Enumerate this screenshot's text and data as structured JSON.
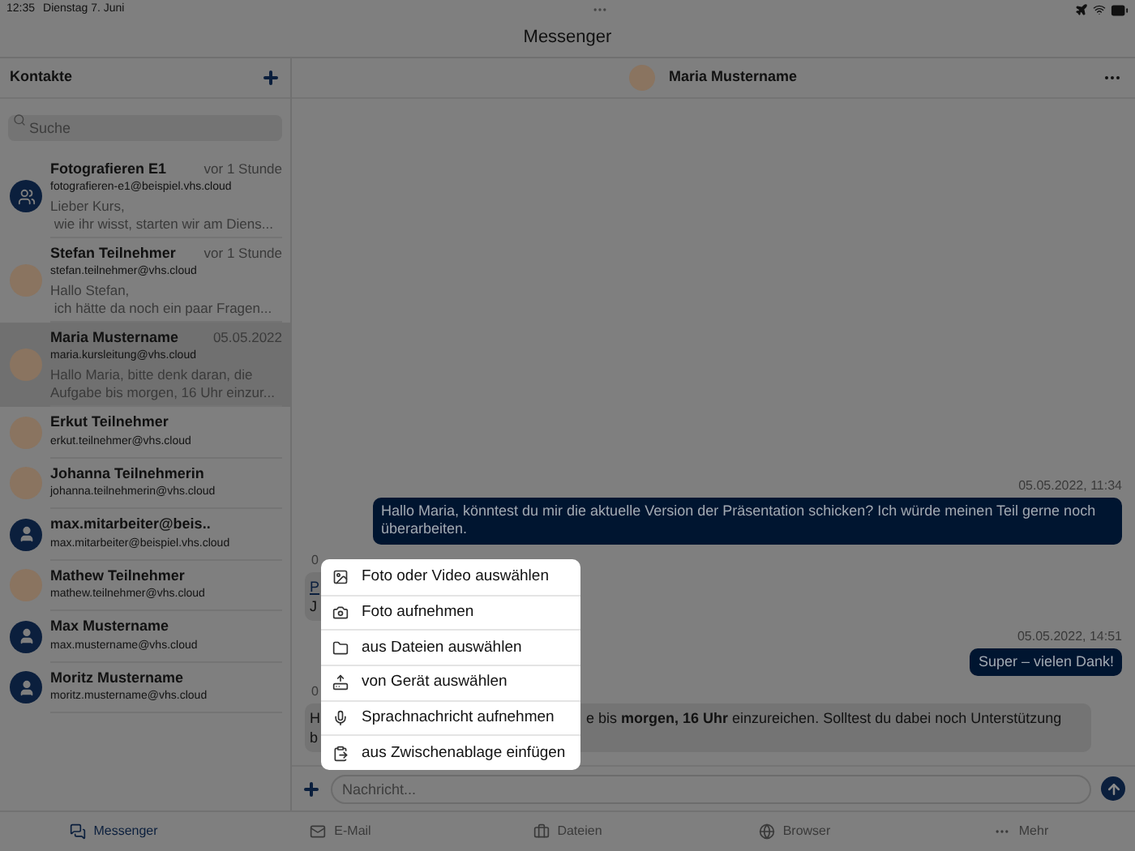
{
  "status_bar": {
    "time": "12:35",
    "date": "Dienstag 7. Juni"
  },
  "title": "Messenger",
  "sidebar": {
    "title": "Kontakte",
    "search": {
      "placeholder": "Suche"
    },
    "contacts": [
      {
        "name": "Fotografieren E1",
        "email": "fotografieren-e1@beispiel.vhs.cloud",
        "time": "vor 1 Stunde",
        "preview": [
          "Lieber Kurs,",
          " wie ihr wisst, starten wir am Diens..."
        ],
        "kind": "group",
        "selected": false
      },
      {
        "name": "Stefan Teilnehmer",
        "email": "stefan.teilnehmer@vhs.cloud",
        "time": "vor 1 Stunde",
        "preview": [
          "Hallo Stefan,",
          " ich hätte da noch ein paar Fragen..."
        ],
        "kind": "photo",
        "selected": false
      },
      {
        "name": "Maria Mustername",
        "email": "maria.kursleitung@vhs.cloud",
        "time": "05.05.2022",
        "preview": [
          "Hallo Maria, bitte denk daran, die",
          "Aufgabe bis morgen, 16 Uhr einzur..."
        ],
        "kind": "photo",
        "selected": true
      },
      {
        "name": "Erkut Teilnehmer",
        "email": "erkut.teilnehmer@vhs.cloud",
        "kind": "photo",
        "selected": false
      },
      {
        "name": "Johanna Teilnehmerin",
        "email": "johanna.teilnehmerin@vhs.cloud",
        "kind": "photo",
        "selected": false
      },
      {
        "name": "max.mitarbeiter@beis..",
        "email": "max.mitarbeiter@beispiel.vhs.cloud",
        "kind": "person",
        "selected": false
      },
      {
        "name": "Mathew Teilnehmer",
        "email": "mathew.teilnehmer@vhs.cloud",
        "kind": "photo",
        "selected": false
      },
      {
        "name": "Max Mustername",
        "email": "max.mustername@vhs.cloud",
        "kind": "person",
        "selected": false
      },
      {
        "name": "Moritz Mustername",
        "email": "moritz.mustername@vhs.cloud",
        "kind": "person",
        "selected": false
      }
    ]
  },
  "chat": {
    "name": "Maria Mustername",
    "messages": [
      {
        "kind": "outgoing",
        "time": "05.05.2022, 11:34",
        "lines": [
          "Hallo Maria, könntest du mir die aktuelle Version der Präsentation schicken? Ich würde meinen Teil gerne noch überarbeiten."
        ]
      },
      {
        "kind": "incoming",
        "time": "0",
        "link": "P",
        "lines": [
          "J"
        ]
      },
      {
        "kind": "outgoing",
        "time": "05.05.2022, 14:51",
        "lines": [
          "Super – vielen Dank!"
        ]
      },
      {
        "kind": "incoming",
        "time": "0",
        "start": "H",
        "rest": "e bis **morgen, 16 Uhr** einzureichen. Solltest du dabei noch Unterstützung",
        "lines": [
          "b"
        ]
      }
    ],
    "input": {
      "placeholder": "Nachricht..."
    }
  },
  "attach_menu": [
    {
      "kind": "image",
      "label": "Foto oder Video auswählen"
    },
    {
      "kind": "camera",
      "label": "Foto aufnehmen"
    },
    {
      "kind": "folder",
      "label": "aus Dateien auswählen"
    },
    {
      "kind": "device",
      "label": "von Gerät auswählen"
    },
    {
      "kind": "mic",
      "label": "Sprachnachricht aufnehmen"
    },
    {
      "kind": "clipboard",
      "label": "aus Zwischenablage einfügen"
    }
  ],
  "tab_bar": [
    {
      "kind": "messenger",
      "label": "Messenger",
      "selected": true
    },
    {
      "kind": "mail",
      "label": "E-Mail",
      "selected": false
    },
    {
      "kind": "files",
      "label": "Dateien",
      "selected": false
    },
    {
      "kind": "browser",
      "label": "Browser",
      "selected": false
    },
    {
      "kind": "more",
      "label": "Mehr",
      "selected": false
    }
  ]
}
